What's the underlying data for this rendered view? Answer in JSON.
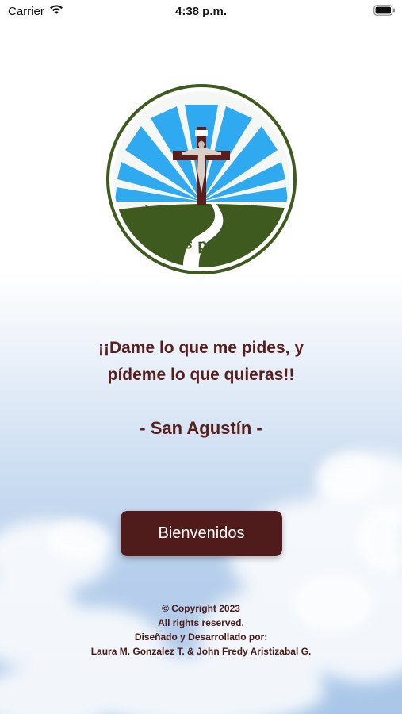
{
  "status_bar": {
    "carrier": "Carrier",
    "time": "4:38 p.m."
  },
  "logo": {
    "text": "¡A Jesús por María!",
    "icon": "crucifix-sunrise-logo"
  },
  "quote": {
    "line1": "¡¡Dame lo que me pides, y",
    "line2": "pídeme lo que quieras!!",
    "author": "- San Agustín -"
  },
  "welcome_button": {
    "label": "Bienvenidos"
  },
  "footer": {
    "copyright": "© Copyright 2023",
    "rights": "All rights reserved.",
    "designed_by": "Diseñado y Desarrollado por:",
    "authors": "Laura M. Gonzalez T. & John Fredy Aristizabal G."
  },
  "colors": {
    "accent": "#4f1c1b",
    "text": "#5a1f1c",
    "logo_ring": "#3f5a1f",
    "logo_rays": "#2fa9ef"
  }
}
